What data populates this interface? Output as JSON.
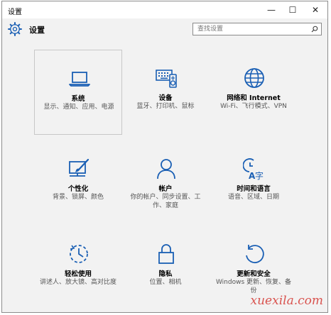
{
  "window": {
    "title": "设置",
    "controls": {
      "minimize": "—",
      "maximize": "☐",
      "close": "✕"
    }
  },
  "header": {
    "title": "设置",
    "search_placeholder": "查找设置"
  },
  "icon_color": "#1a5fb4",
  "tiles": [
    {
      "label": "系统",
      "desc": "显示、通知、应用、电源",
      "icon": "laptop-icon"
    },
    {
      "label": "设备",
      "desc": "蓝牙、打印机、鼠标",
      "icon": "devices-icon"
    },
    {
      "label": "网络和 Internet",
      "desc": "Wi-Fi、飞行模式、VPN",
      "icon": "globe-icon"
    },
    {
      "label": "个性化",
      "desc": "背景、锁屏、颜色",
      "icon": "personalization-icon"
    },
    {
      "label": "帐户",
      "desc": "你的帐户、同步设置、工作、家庭",
      "icon": "account-icon"
    },
    {
      "label": "时间和语言",
      "desc": "语音、区域、日期",
      "icon": "time-language-icon"
    },
    {
      "label": "轻松使用",
      "desc": "讲述人、放大镜、高对比度",
      "icon": "ease-of-access-icon"
    },
    {
      "label": "隐私",
      "desc": "位置、相机",
      "icon": "lock-icon"
    },
    {
      "label": "更新和安全",
      "desc": "Windows 更新、恢复、备份",
      "icon": "update-icon"
    }
  ],
  "watermark": "xuexila.com"
}
